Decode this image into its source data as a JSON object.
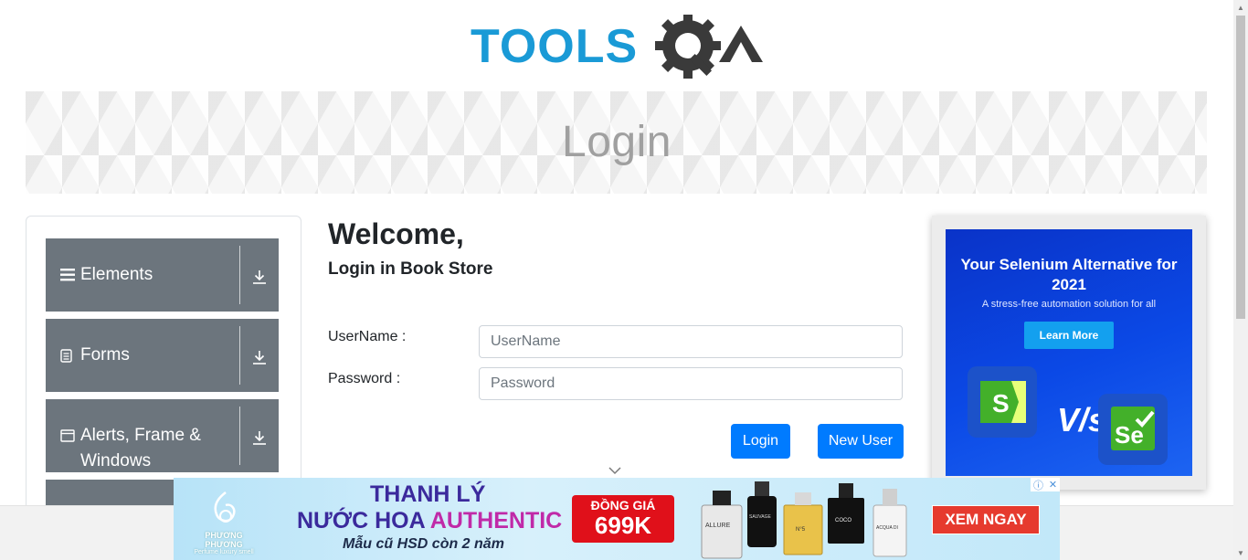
{
  "logo": {
    "text_left": "TOOLS",
    "text_right": "QA",
    "alt": "ToolsQA"
  },
  "banner": {
    "title": "Login"
  },
  "nav": {
    "groups": [
      {
        "label": "Elements",
        "icon": "hamburger-icon"
      },
      {
        "label": "Forms",
        "icon": "form-icon"
      },
      {
        "label": "Alerts, Frame & Windows",
        "icon": "window-icon"
      }
    ]
  },
  "form": {
    "heading": "Welcome,",
    "subheading": "Login in Book Store",
    "username_label": "UserName :",
    "username_placeholder": "UserName",
    "username_value": "",
    "password_label": "Password :",
    "password_placeholder": "Password",
    "password_value": "",
    "login_button": "Login",
    "new_user_button": "New User"
  },
  "right_ad": {
    "title": "Your Selenium Alternative for 2021",
    "subtitle": "A stress-free automation solution for all",
    "cta": "Learn More",
    "vs_text": "V/s",
    "left_logo": "S",
    "right_logo": "Se"
  },
  "bottom_ad": {
    "brand": "PHƯƠNG PHƯƠNG",
    "brand_tagline": "Perfume luxury smell",
    "line1": "THANH LÝ",
    "line2_a": "NƯỚC HOA",
    "line2_b": "AUTHENTIC",
    "line3": "Mẫu cũ HSD còn 2 năm",
    "price_label": "ĐỒNG GIÁ",
    "price": "699K",
    "cta": "XEM NGAY",
    "products": [
      "ALLURE",
      "SAUVAGE",
      "N°5",
      "COCO",
      "ACQUA DI"
    ]
  },
  "colors": {
    "accent": "#007bff",
    "nav_bg": "#6c757d",
    "logo_blue": "#1a9ad6",
    "logo_dark": "#3a3a3a"
  }
}
